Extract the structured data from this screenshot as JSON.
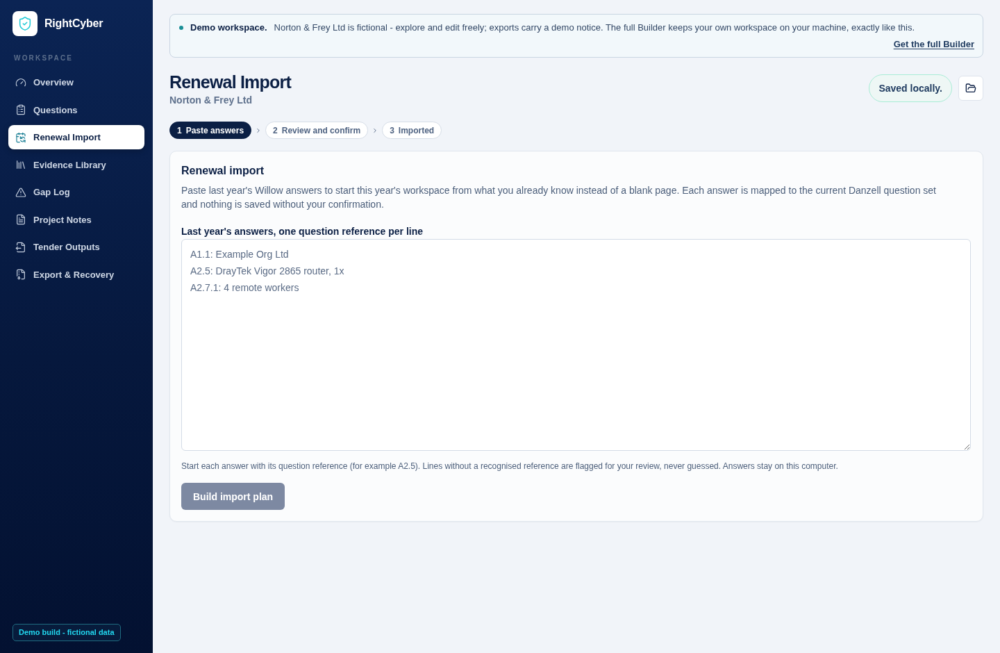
{
  "sidebar": {
    "brand": "RightCyber",
    "section_label": "WORKSPACE",
    "items": [
      {
        "label": "Overview",
        "selected": false
      },
      {
        "label": "Questions",
        "selected": false
      },
      {
        "label": "Renewal Import",
        "selected": true
      },
      {
        "label": "Evidence Library",
        "selected": false
      },
      {
        "label": "Gap Log",
        "selected": false
      },
      {
        "label": "Project Notes",
        "selected": false
      },
      {
        "label": "Tender Outputs",
        "selected": false
      },
      {
        "label": "Export & Recovery",
        "selected": false
      }
    ],
    "footer_badge": "Demo build - fictional data"
  },
  "banner": {
    "title": "Demo workspace.",
    "message": "Norton & Frey Ltd is fictional - explore and edit freely; exports carry a demo notice. The full Builder keeps your own workspace on your machine, exactly like this.",
    "link": "Get the full Builder"
  },
  "header": {
    "title": "Renewal Import",
    "subtitle": "Norton & Frey Ltd",
    "save_status": "Saved locally."
  },
  "steps": [
    {
      "number": "1",
      "label": "Paste answers",
      "selected": true
    },
    {
      "number": "2",
      "label": "Review and confirm",
      "selected": false
    },
    {
      "number": "3",
      "label": "Imported",
      "selected": false
    }
  ],
  "card": {
    "title": "Renewal import",
    "description": "Paste last year's Willow answers to start this year's workspace from what you already know instead of a blank page. Each answer is mapped to the current Danzell question set and nothing is saved without your confirmation.",
    "field_label": "Last year's answers, one question reference per line",
    "field": {
      "placeholder": "A1.1: Example Org Ltd\nA2.5: DrayTek Vigor 2865 router, 1x\nA2.7.1: 4 remote workers"
    },
    "hint": "Start each answer with its question reference (for example A2.5). Lines without a recognised reference are flagged for your review, never guessed. Answers stay on this computer.",
    "button": {
      "label": "Build import plan",
      "disabled": true
    }
  }
}
